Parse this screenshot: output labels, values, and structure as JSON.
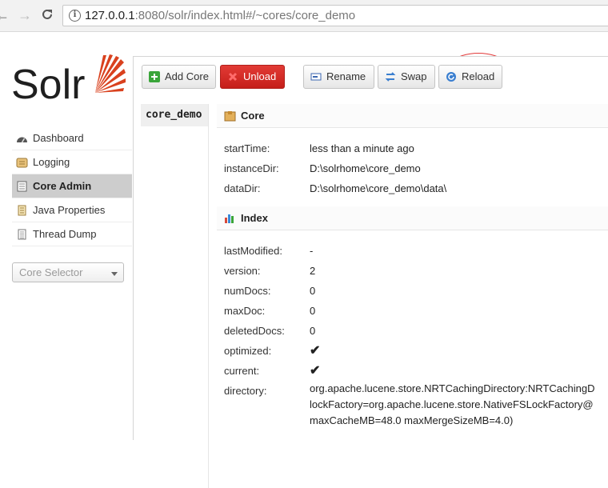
{
  "browser": {
    "url_host": "127.0.0.1",
    "url_rest": ":8080/solr/index.html#/~cores/core_demo"
  },
  "logo": {
    "text": "Solr"
  },
  "sidebar": {
    "items": [
      {
        "label": "Dashboard",
        "icon": "dashboard-icon"
      },
      {
        "label": "Logging",
        "icon": "logging-icon"
      },
      {
        "label": "Core Admin",
        "icon": "core-admin-icon",
        "active": true
      },
      {
        "label": "Java Properties",
        "icon": "java-properties-icon"
      },
      {
        "label": "Thread Dump",
        "icon": "thread-dump-icon"
      }
    ],
    "core_selector_placeholder": "Core Selector"
  },
  "toolbar": {
    "add_core": "Add Core",
    "unload": "Unload",
    "rename": "Rename",
    "swap": "Swap",
    "reload": "Reload"
  },
  "cores": [
    "core_demo"
  ],
  "core_section": {
    "title": "Core",
    "rows": [
      {
        "key": "startTime:",
        "value": "less than a minute ago"
      },
      {
        "key": "instanceDir:",
        "value": "D:\\solrhome\\core_demo"
      },
      {
        "key": "dataDir:",
        "value": "D:\\solrhome\\core_demo\\data\\"
      }
    ]
  },
  "index_section": {
    "title": "Index",
    "rows": [
      {
        "key": "lastModified:",
        "value": "-"
      },
      {
        "key": "version:",
        "value": "2"
      },
      {
        "key": "numDocs:",
        "value": "0"
      },
      {
        "key": "maxDoc:",
        "value": "0"
      },
      {
        "key": "deletedDocs:",
        "value": "0"
      },
      {
        "key": "optimized:",
        "value": "✔"
      },
      {
        "key": "current:",
        "value": "✔"
      }
    ],
    "directory_key": "directory:",
    "directory_lines": [
      "org.apache.lucene.store.NRTCachingDirectory:NRTCachingD",
      "lockFactory=org.apache.lucene.store.NativeFSLockFactory@",
      "maxCacheMB=48.0 maxMergeSizeMB=4.0)"
    ]
  },
  "colors": {
    "unload_button": "#d22d27",
    "annotation_circle": "#e23a3a",
    "check": "#3aa53a"
  }
}
